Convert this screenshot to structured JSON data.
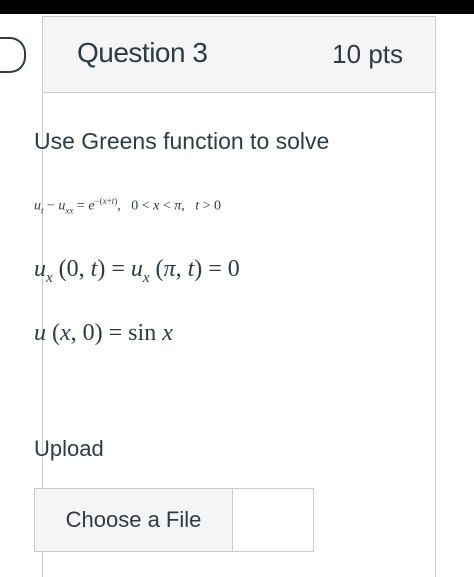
{
  "question": {
    "title": "Question 3",
    "points": "10 pts",
    "prompt": "Use Greens function to solve",
    "equations": [
      "u_t − u_xx = e^{−(x+t)},  0 < x < π,  t > 0",
      "u_x(0, t) = u_x(π, t) = 0",
      "u(x, 0) = sin x"
    ],
    "equation_display": {
      "eq1_text": "uₜ − uₓₓ = e⁻⁽ˣ⁺ᵗ⁾,   0 < x < π,   t > 0",
      "eq2_text": "uₓ (0, t) = uₓ (π, t) = 0",
      "eq3_text": "u (x, 0) = sin x"
    }
  },
  "upload": {
    "label": "Upload",
    "choose_file_label": "Choose a File",
    "file_name": ""
  },
  "colors": {
    "text": "#2d3b45",
    "header_bg": "#f5f5f5",
    "border": "#c7cdd1"
  }
}
